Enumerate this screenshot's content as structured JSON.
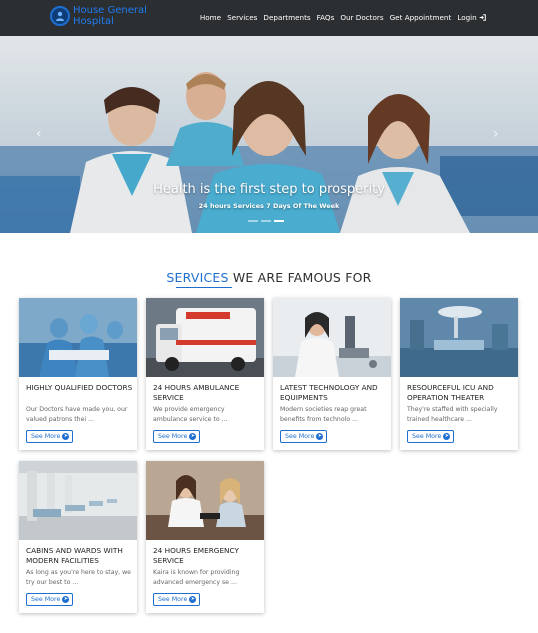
{
  "brand": {
    "name_line1": "House General",
    "name_line2": "Hospital"
  },
  "nav": {
    "items": [
      "Home",
      "Services",
      "Departments",
      "FAQs",
      "Our Doctors",
      "Get Appointment",
      "Login"
    ]
  },
  "hero": {
    "title": "Health is the first step to prosperity",
    "subtitle": "24 hours Services 7 Days Of The Week",
    "prev_icon": "chevron-left-icon",
    "next_icon": "chevron-right-icon",
    "slide_count": 3,
    "active_slide": 3
  },
  "services": {
    "title_accent": "SERVICES",
    "title_rest": " WE ARE FAMOUS FOR",
    "cards": [
      {
        "title": "HIGHLY QUALIFIED DOCTORS",
        "text": "Our Doctors have made you, our valued patrons thei ...",
        "button": "See More"
      },
      {
        "title": "24 HOURS AMBULANCE SERVICE",
        "text": "We provide emergency ambulance service to ...",
        "button": "See More"
      },
      {
        "title": "LATEST TECHNOLOGY AND EQUIPMENTS",
        "text": "Modern societies reap great benefits from technolo ...",
        "button": "See More"
      },
      {
        "title": "RESOURCEFUL ICU AND OPERATION THEATER",
        "text": "They're staffed with specially trained healthcare ...",
        "button": "See More"
      },
      {
        "title": "CABINS AND WARDS WITH MODERN FACILITIES",
        "text": "As long as you're here to stay, we try our best to ...",
        "button": "See More"
      },
      {
        "title": "24 HOURS EMERGENCY SERVICE",
        "text": "Kaira is known for providing advanced emergency se ...",
        "button": "See More"
      }
    ]
  },
  "colors": {
    "navbar": "#2b2f32",
    "accent": "#1f6fd1",
    "brand": "#1f7cf0"
  }
}
